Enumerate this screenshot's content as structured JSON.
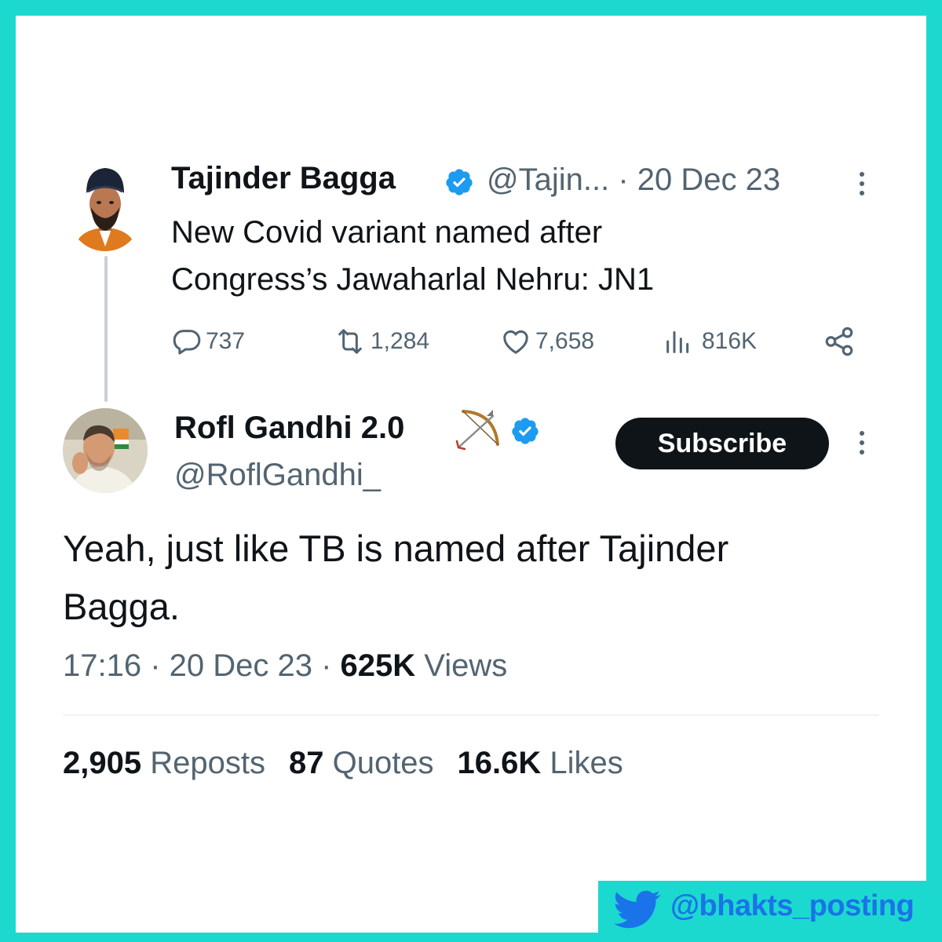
{
  "colors": {
    "frame": "#1cd9d0",
    "text_primary": "#0f1419",
    "text_secondary": "#536471",
    "verified_blue": "#1d9bf0",
    "watermark_text": "#1a73e8"
  },
  "parent_tweet": {
    "avatar_icon": "avatar-turban-portrait",
    "display_name": "Tajinder Bagga",
    "meta": "@Tajin... · 20 Dec 23",
    "text_line1": "New Covid variant named after",
    "text_line2": "Congress’s Jawaharlal Nehru: JN1",
    "stats": {
      "replies": "737",
      "reposts": "1,284",
      "likes": "7,658",
      "views": "816K"
    }
  },
  "main_tweet": {
    "avatar_icon": "avatar-portrait",
    "display_name": "Rofl Gandhi 2.0",
    "handle": "@RoflGandhi_",
    "subscribe_label": "Subscribe",
    "text_line1": "Yeah, just like TB is named after Tajinder",
    "text_line2": "Bagga.",
    "time_date": "17:16 · 20 Dec 23 · ",
    "views_count": "625K",
    "views_label": " Views",
    "reposts_count": "2,905",
    "reposts_label": " Reposts",
    "quotes_count": "87",
    "quotes_label": " Quotes",
    "likes_count": "16.6K",
    "likes_label": " Likes"
  },
  "watermark": {
    "icon": "twitter-bird-icon",
    "text": "@bhakts_posting"
  }
}
